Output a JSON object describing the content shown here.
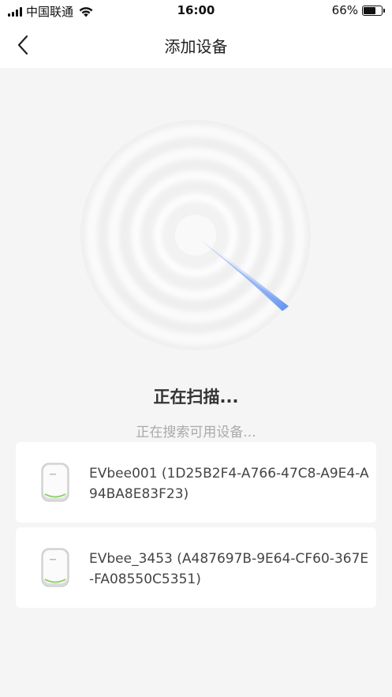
{
  "status_bar": {
    "carrier": "中国联通",
    "time": "16:00",
    "battery": "66%",
    "battery_level": 0.66
  },
  "nav": {
    "title": "添加设备",
    "back_icon": "chevron-left-icon"
  },
  "scan": {
    "title": "正在扫描...",
    "subtitle": "正在搜索可用设备..."
  },
  "devices": [
    {
      "name": "EVbee001 (1D25B2F4-A766-47C8-A9E4-A94BA8E83F23)",
      "icon": "charger-device-icon"
    },
    {
      "name": "EVbee_3453 (A487697B-9E64-CF60-367E-FA08550C5351)",
      "icon": "charger-device-icon"
    }
  ],
  "colors": {
    "background": "#f5f5f5",
    "card": "#ffffff",
    "radar_beam": "#5b8ff0",
    "device_led": "#8fd36b"
  }
}
